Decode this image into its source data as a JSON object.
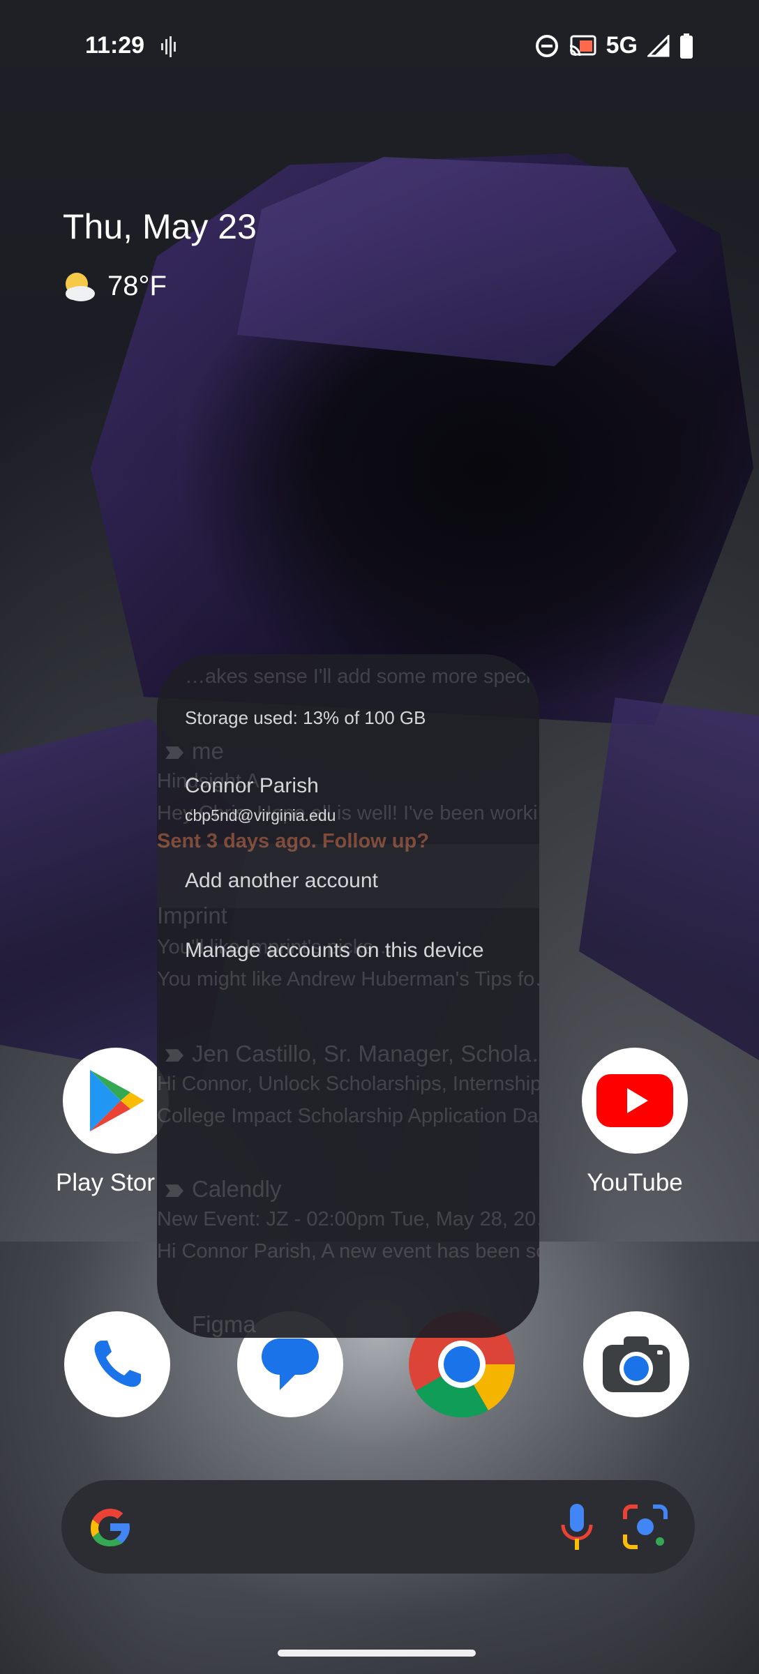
{
  "status_bar": {
    "time": "11:29",
    "network": "5G",
    "icons": [
      "sound-wave-icon",
      "do-not-disturb-icon",
      "cast-icon",
      "signal-icon",
      "battery-icon"
    ]
  },
  "widget": {
    "date": "Thu, May 23",
    "temperature": "78°F",
    "weather_icon": "partly-cloudy-icon"
  },
  "home_apps": [
    {
      "label": "Play Store",
      "visible_label": "Play Stor",
      "icon": "play-store-icon"
    },
    {
      "label": "YouTube",
      "icon": "youtube-icon"
    }
  ],
  "dock": [
    {
      "name": "phone-icon"
    },
    {
      "name": "messages-icon"
    },
    {
      "name": "chrome-icon"
    },
    {
      "name": "camera-icon"
    }
  ],
  "search_bar": {
    "icons": [
      "google-g-icon",
      "microphone-icon",
      "lens-icon"
    ]
  },
  "account_menu": {
    "storage": "Storage used: 13% of 100 GB",
    "name": "Connor Parish",
    "email": "cbp5nd@virginia.edu",
    "add_account": "Add another account",
    "manage_accounts": "Manage accounts on this device"
  },
  "ghost_emails": {
    "line1": "…akes sense I'll add some more speci…",
    "me": "me",
    "hindsight": "Hindsight A…",
    "hey": "Hey Chris, Hope all is well! I've been worki…",
    "followup": "Sent 3 days ago. Follow up?",
    "imprint": "Imprint",
    "imprint_l1": "You'll like Imprint's picks…",
    "imprint_l2": "You might like Andrew Huberman's Tips fo…",
    "jen": "Jen Castillo, Sr. Manager, Schola…",
    "jen_l1": "Hi Connor, Unlock Scholarships, Internship…",
    "jen_l2": "College Impact Scholarship Application Da…",
    "calendly": "Calendly",
    "cal_l1": "New Event: JZ - 02:00pm Tue, May 28, 20…",
    "cal_l2": "Hi Connor Parish, A new event has been sc…",
    "figma": "Figma"
  }
}
